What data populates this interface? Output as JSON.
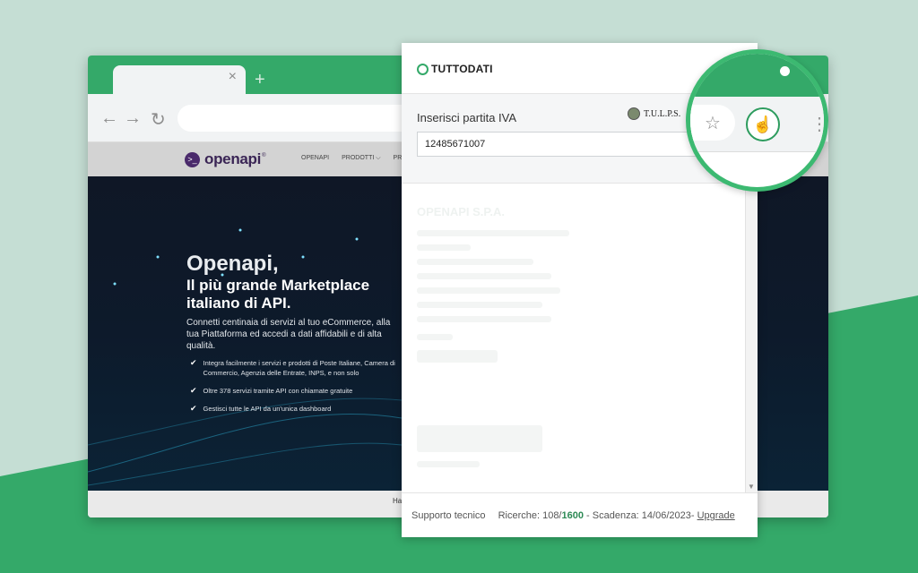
{
  "colors": {
    "brand_green": "#34a969",
    "background": "#c5ded4",
    "accent_text": "#2d8a55"
  },
  "browser": {
    "tab_close": "×",
    "tab_new": "+",
    "nav": {
      "back": "←",
      "forward": "→",
      "reload": "↻"
    }
  },
  "site": {
    "logo": "openapi",
    "logo_mark": ">_",
    "logo_reg": "®",
    "menu": [
      "OPENAPI",
      "PRODOTTI ⌵",
      "PRE"
    ],
    "hero_title": "Openapi,",
    "hero_subtitle": "Il più grande Marketplace italiano di API.",
    "hero_description": "Connetti centinaia di servizi al tuo eCommerce, alla tua Piattaforma ed accedi a dati affidabili e di alta qualità.",
    "hero_points": [
      "Integra facilmente i servizi e prodotti di Poste Italiane, Camera di Commercio, Agenzia delle Entrate, INPS, e non solo",
      "Oltre 378 servizi tramite API con chiamate gratuite",
      "Gestisci tutte le API da un'unica dashboard"
    ],
    "footer": "Ha"
  },
  "popup": {
    "brand": "TUTTODATI",
    "form_label": "Inserisci partita IVA",
    "tulps_label": "T.U.L.P.S.",
    "piva_value": "12485671007",
    "faded_title": "OPENAPI S.P.A.",
    "footer": {
      "support": "Supporto tecnico",
      "searches_label": "Ricerche: 108/",
      "searches_total": "1600",
      "expiry": " - Scadenza: 14/06/2023- ",
      "upgrade": "Upgrade"
    }
  },
  "magnifier": {
    "star": "☆",
    "ext_icon": "☝",
    "menu": "⋮"
  }
}
